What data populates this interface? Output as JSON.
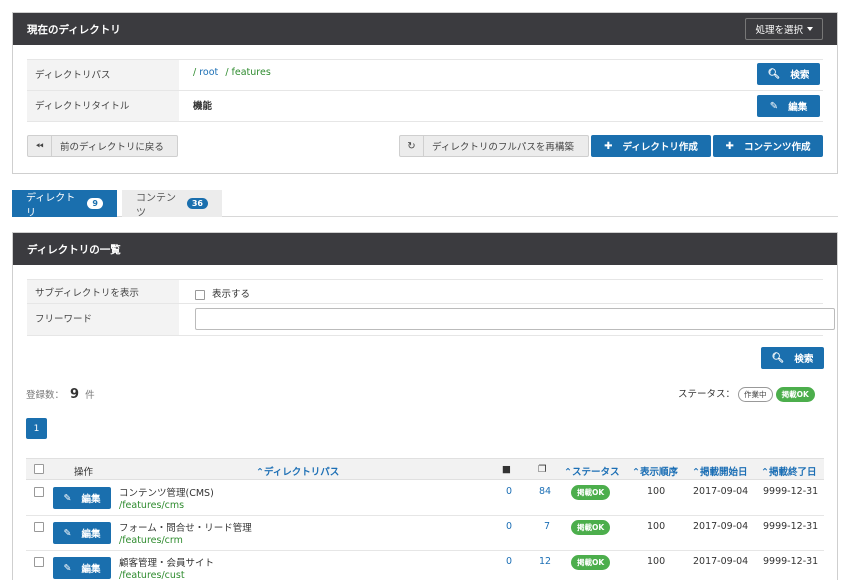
{
  "top_panel": {
    "title": "現在のディレクトリ",
    "action_select": "処理を選択",
    "path_label": "ディレクトリパス",
    "path_sep1": "/",
    "path_root": "root",
    "path_sep2": "/",
    "path_current": "features",
    "title_label": "ディレクトリタイトル",
    "title_value": "機能",
    "search_label": "検索",
    "edit_label": "編集",
    "back_label": "前のディレクトリに戻る",
    "rebuild_label": "ディレクトリのフルパスを再構築",
    "create_dir_label": "ディレクトリ作成",
    "create_content_label": "コンテンツ作成"
  },
  "tabs": [
    {
      "label": "ディレクトリ",
      "count": "9"
    },
    {
      "label": "コンテンツ",
      "count": "36"
    }
  ],
  "list_panel": {
    "title": "ディレクトリの一覧",
    "show_sub_label": "サブディレクトリを表示",
    "show_sub_option": "表示する",
    "freeword_label": "フリーワード",
    "freeword_value": "",
    "search_label": "検索",
    "count_label": "登録数：",
    "count_value": "9",
    "count_unit": "件",
    "status_label": "ステータス：",
    "status_draft": "作業中",
    "status_ok": "掲載OK",
    "page": "1"
  },
  "table": {
    "headers": {
      "action": "操作",
      "path": "ディレクトリパス",
      "status": "ステータス",
      "order": "表示順序",
      "start": "掲載開始日",
      "end": "掲載終了日"
    },
    "edit_label": "編集",
    "rows": [
      {
        "title": "コンテンツ管理(CMS)",
        "path": "/features/cms",
        "dirs": "0",
        "contents": "84",
        "status": "掲載OK",
        "order": "100",
        "start": "2017-09-04",
        "end": "9999-12-31"
      },
      {
        "title": "フォーム・問合せ・リード管理",
        "path": "/features/crm",
        "dirs": "0",
        "contents": "7",
        "status": "掲載OK",
        "order": "100",
        "start": "2017-09-04",
        "end": "9999-12-31"
      },
      {
        "title": "顧客管理・会員サイト",
        "path": "/features/cust",
        "dirs": "0",
        "contents": "12",
        "status": "掲載OK",
        "order": "100",
        "start": "2017-09-04",
        "end": "9999-12-31"
      }
    ]
  }
}
